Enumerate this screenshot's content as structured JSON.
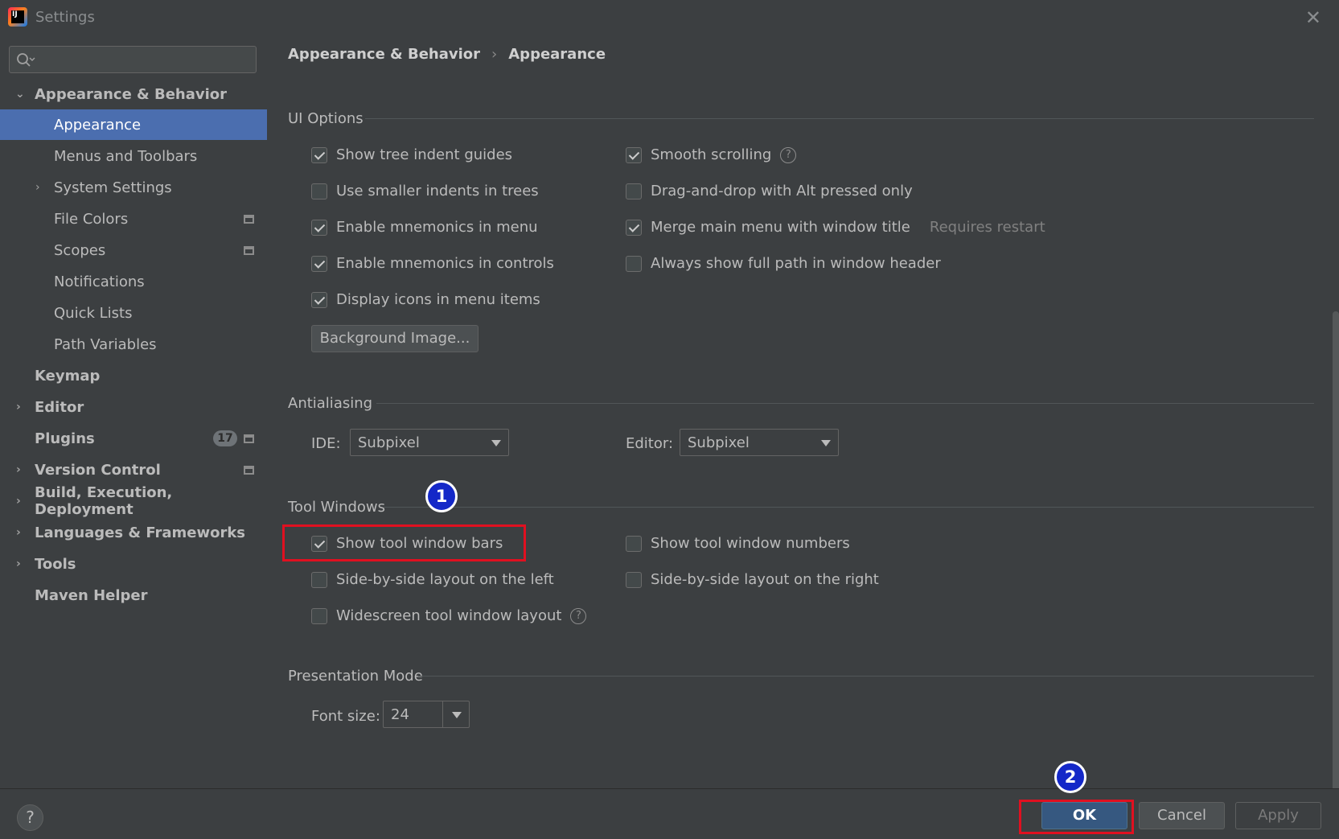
{
  "window": {
    "title": "Settings",
    "logo_text": "IJ"
  },
  "search": {
    "placeholder": ""
  },
  "sidebar": {
    "items": [
      {
        "label": "Appearance & Behavior"
      },
      {
        "label": "Appearance"
      },
      {
        "label": "Menus and Toolbars"
      },
      {
        "label": "System Settings"
      },
      {
        "label": "File Colors"
      },
      {
        "label": "Scopes"
      },
      {
        "label": "Notifications"
      },
      {
        "label": "Quick Lists"
      },
      {
        "label": "Path Variables"
      },
      {
        "label": "Keymap"
      },
      {
        "label": "Editor"
      },
      {
        "label": "Plugins",
        "badge": "17"
      },
      {
        "label": "Version Control"
      },
      {
        "label": "Build, Execution, Deployment"
      },
      {
        "label": "Languages & Frameworks"
      },
      {
        "label": "Tools"
      },
      {
        "label": "Maven Helper"
      }
    ]
  },
  "breadcrumb": {
    "parent": "Appearance & Behavior",
    "separator": "›",
    "current": "Appearance"
  },
  "ui_options": {
    "title": "UI Options",
    "show_tree_indent_guides": {
      "label": "Show tree indent guides",
      "checked": true
    },
    "use_smaller_indents": {
      "label": "Use smaller indents in trees",
      "checked": false
    },
    "enable_mnemonics_menu": {
      "label": "Enable mnemonics in menu",
      "checked": true
    },
    "enable_mnemonics_controls": {
      "label": "Enable mnemonics in controls",
      "checked": true
    },
    "display_icons_menu": {
      "label": "Display icons in menu items",
      "checked": true
    },
    "smooth_scrolling": {
      "label": "Smooth scrolling",
      "checked": true
    },
    "drag_and_drop_alt": {
      "label": "Drag-and-drop with Alt pressed only",
      "checked": false
    },
    "merge_main_menu": {
      "label": "Merge main menu with window title",
      "checked": true,
      "note": "Requires restart"
    },
    "always_show_full_path": {
      "label": "Always show full path in window header",
      "checked": false
    },
    "background_image_button": "Background Image..."
  },
  "antialiasing": {
    "title": "Antialiasing",
    "ide_label": "IDE:",
    "ide_value": "Subpixel",
    "editor_label": "Editor:",
    "editor_value": "Subpixel"
  },
  "tool_windows": {
    "title": "Tool Windows",
    "show_tool_window_bars": {
      "label": "Show tool window bars",
      "checked": true
    },
    "side_by_side_left": {
      "label": "Side-by-side layout on the left",
      "checked": false
    },
    "widescreen_layout": {
      "label": "Widescreen tool window layout",
      "checked": false
    },
    "show_tool_window_numbers": {
      "label": "Show tool window numbers",
      "checked": false
    },
    "side_by_side_right": {
      "label": "Side-by-side layout on the right",
      "checked": false
    }
  },
  "presentation_mode": {
    "title": "Presentation Mode",
    "font_size_label": "Font size:",
    "font_size_value": "24"
  },
  "annotations": {
    "step1": "1",
    "step2": "2",
    "highlight_color": "#e01020",
    "marker_color": "#1428c8"
  },
  "footer": {
    "help": "?",
    "ok": "OK",
    "cancel": "Cancel",
    "apply": "Apply"
  },
  "colors": {
    "background": "#3c3f41",
    "selection": "#4b6eaf",
    "ok_button": "#365880"
  }
}
